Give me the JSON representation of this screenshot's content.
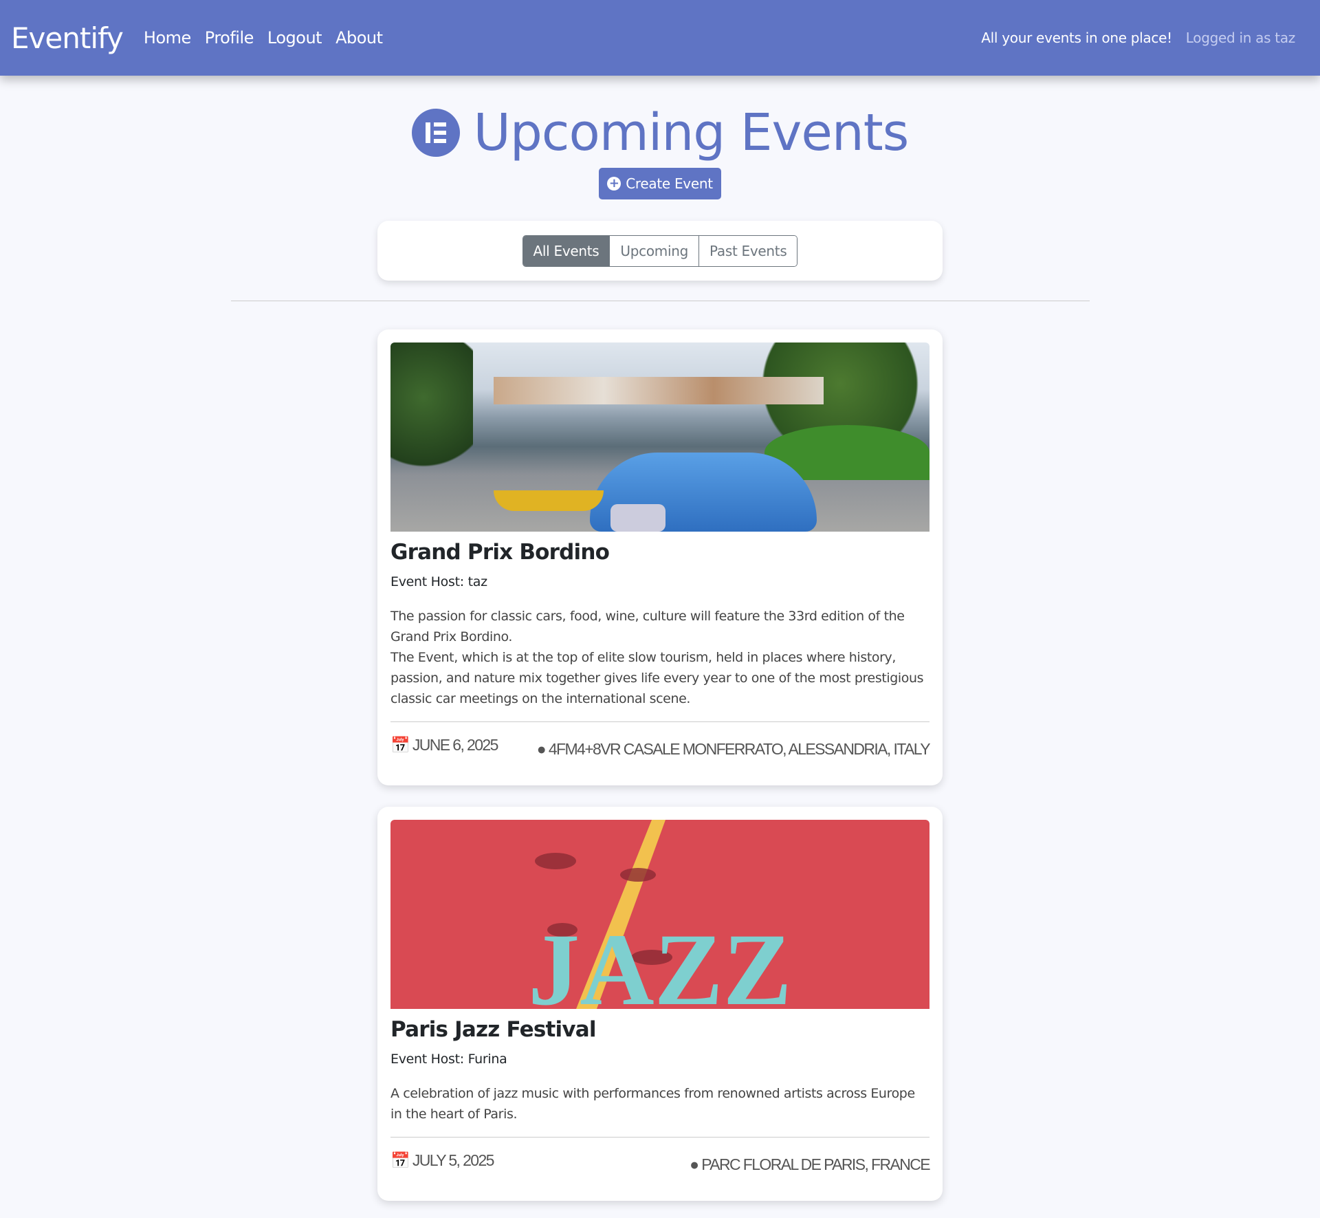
{
  "nav": {
    "brand": "Eventify",
    "links": [
      "Home",
      "Profile",
      "Logout",
      "About"
    ],
    "tagline": "All your events in one place!",
    "user": "Logged in as taz"
  },
  "page": {
    "title": "Upcoming Events",
    "create_label": "Create Event"
  },
  "filters": {
    "options": [
      "All Events",
      "Upcoming",
      "Past Events"
    ],
    "selected": "All Events"
  },
  "colors": {
    "brand": "#5f74c4",
    "secondary": "#6c757d",
    "jazz_bg": "#d94a53",
    "jazz_letters": "#7ecfcf"
  },
  "events": [
    {
      "title": "Grand Prix Bordino",
      "host": "Event Host: taz",
      "description": "The passion for classic cars, food, wine, culture will feature the 33rd edition of the Grand Prix Bordino.\nThe Event, which is at the top of elite slow tourism, held in places where history, passion, and nature mix together gives life every year to one of the most prestigious classic car meetings on the international scene.",
      "date": "June 6, 2025",
      "location": "4FM4+8VR Casale Monferrato, Alessandria, Italy"
    },
    {
      "title": "Paris Jazz Festival",
      "host": "Event Host: Furina",
      "description": "A celebration of jazz music with performances from renowned artists across Europe in the heart of Paris.",
      "date": "July 5, 2025",
      "location": "Parc Floral de Paris, France",
      "image_lettering": "JAZZ"
    }
  ]
}
